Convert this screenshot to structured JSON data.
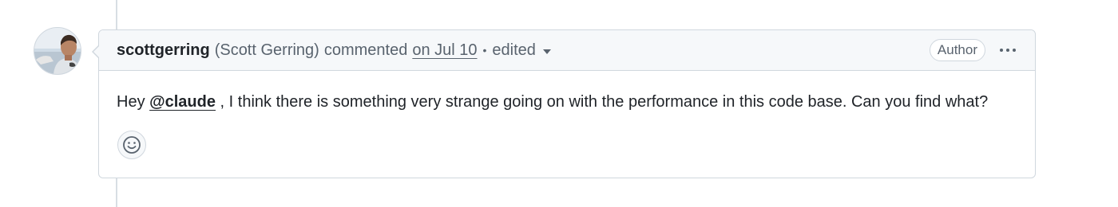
{
  "comment": {
    "author_login": "scottgerring",
    "author_full_name": "(Scott Gerring)",
    "action": "commented",
    "timestamp": "on Jul 10",
    "separator": "•",
    "edited_label": "edited",
    "author_badge": "Author",
    "body_prefix": "Hey ",
    "mention": "@claude",
    "body_suffix": " , I think there is something very strange going on with the performance in this code base. Can you find what?"
  },
  "icons": {
    "avatar": "user-avatar-photo",
    "edited_dropdown": "triangle-down-icon",
    "more_actions": "kebab-horizontal-icon",
    "reaction": "smiley-icon"
  },
  "colors": {
    "border": "#d0d7de",
    "header_bg": "#f6f8fa",
    "muted_text": "#59636e",
    "primary_text": "#1f2328"
  }
}
